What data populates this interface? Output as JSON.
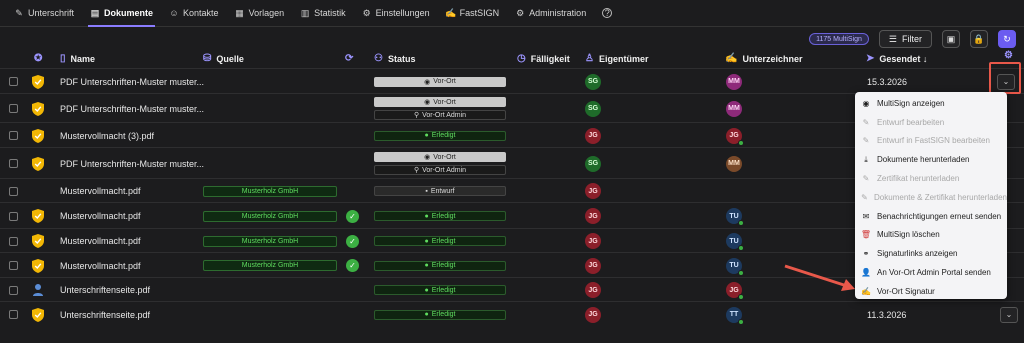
{
  "nav": [
    {
      "label": "Unterschrift",
      "icon": "pen-icon",
      "glyph": "✎",
      "active": false
    },
    {
      "label": "Dokumente",
      "icon": "document-icon",
      "glyph": "▤",
      "active": true
    },
    {
      "label": "Kontakte",
      "icon": "contacts-icon",
      "glyph": "☺",
      "active": false
    },
    {
      "label": "Vorlagen",
      "icon": "templates-icon",
      "glyph": "▦",
      "active": false
    },
    {
      "label": "Statistik",
      "icon": "statistics-icon",
      "glyph": "▥",
      "active": false
    },
    {
      "label": "Einstellungen",
      "icon": "settings-icon",
      "glyph": "⚙",
      "active": false
    },
    {
      "label": "FastSIGN",
      "icon": "fastsign-icon",
      "glyph": "✍",
      "active": false
    },
    {
      "label": "Administration",
      "icon": "admin-gear-icon",
      "glyph": "⚙",
      "active": false
    },
    {
      "label": "",
      "icon": "help-icon",
      "glyph": "?",
      "active": false
    }
  ],
  "toolbar": {
    "multisign_count": "1175 MultiSign",
    "filter_label": "Filter"
  },
  "columns": {
    "name": "Name",
    "source": "Quelle",
    "status": "Status",
    "due": "Fälligkeit",
    "owner": "Eigentümer",
    "signer": "Unterzeichner",
    "sent": "Gesendet ↓"
  },
  "rows": [
    {
      "name": "PDF Unterschriften-Muster muster...",
      "icon": "shield",
      "source": "",
      "synced": false,
      "status": [
        {
          "label": "Vor-Ort",
          "kind": "vor"
        }
      ],
      "owner": "SG",
      "owner_color": "sg",
      "signer": "MM",
      "signer_color": "mm",
      "signer_done": false,
      "sent": "15.3.2026"
    },
    {
      "name": "PDF Unterschriften-Muster muster...",
      "icon": "shield",
      "source": "",
      "synced": false,
      "status": [
        {
          "label": "Vor-Ort",
          "kind": "vor"
        },
        {
          "label": "Vor-Ort Admin",
          "kind": "admin"
        }
      ],
      "owner": "SG",
      "owner_color": "sg",
      "signer": "MM",
      "signer_color": "mm",
      "signer_done": false,
      "sent": ""
    },
    {
      "name": "Mustervollmacht (3).pdf",
      "icon": "shield",
      "source": "",
      "synced": false,
      "status": [
        {
          "label": "Erledigt",
          "kind": "ok"
        }
      ],
      "owner": "JG",
      "owner_color": "jg",
      "signer": "JG",
      "signer_color": "jg",
      "signer_done": true,
      "sent": ""
    },
    {
      "name": "PDF Unterschriften-Muster muster...",
      "icon": "shield",
      "source": "",
      "synced": false,
      "status": [
        {
          "label": "Vor-Ort",
          "kind": "vor"
        },
        {
          "label": "Vor-Ort Admin",
          "kind": "admin"
        }
      ],
      "owner": "SG",
      "owner_color": "sg",
      "signer": "MM",
      "signer_color": "mm2",
      "signer_done": false,
      "sent": ""
    },
    {
      "name": "Mustervollmacht.pdf",
      "icon": "none",
      "source": "Musterholz GmbH",
      "synced": false,
      "status": [
        {
          "label": "Entwurf",
          "kind": "ent"
        }
      ],
      "owner": "JG",
      "owner_color": "jg",
      "signer": "",
      "signer_color": "",
      "signer_done": false,
      "sent": ""
    },
    {
      "name": "Mustervollmacht.pdf",
      "icon": "shield",
      "source": "Musterholz GmbH",
      "synced": true,
      "status": [
        {
          "label": "Erledigt",
          "kind": "ok"
        }
      ],
      "owner": "JG",
      "owner_color": "jg",
      "signer": "TU",
      "signer_color": "tu",
      "signer_done": true,
      "sent": ""
    },
    {
      "name": "Mustervollmacht.pdf",
      "icon": "shield",
      "source": "Musterholz GmbH",
      "synced": true,
      "status": [
        {
          "label": "Erledigt",
          "kind": "ok"
        }
      ],
      "owner": "JG",
      "owner_color": "jg",
      "signer": "TU",
      "signer_color": "tu",
      "signer_done": true,
      "sent": ""
    },
    {
      "name": "Mustervollmacht.pdf",
      "icon": "shield",
      "source": "Musterholz GmbH",
      "synced": true,
      "status": [
        {
          "label": "Erledigt",
          "kind": "ok"
        }
      ],
      "owner": "JG",
      "owner_color": "jg",
      "signer": "TU",
      "signer_color": "tu",
      "signer_done": true,
      "sent": ""
    },
    {
      "name": "Unterschriftenseite.pdf",
      "icon": "person",
      "source": "",
      "synced": false,
      "status": [
        {
          "label": "Erledigt",
          "kind": "ok"
        }
      ],
      "owner": "JG",
      "owner_color": "jg",
      "signer": "JG",
      "signer_color": "jg",
      "signer_done": true,
      "sent": ""
    },
    {
      "name": "Unterschriftenseite.pdf",
      "icon": "shield",
      "source": "",
      "synced": false,
      "status": [
        {
          "label": "Erledigt",
          "kind": "ok"
        }
      ],
      "owner": "JG",
      "owner_color": "jg",
      "signer": "TT",
      "signer_color": "tu",
      "signer_done": true,
      "sent": "11.3.2026"
    }
  ],
  "menu": [
    {
      "label": "MultiSign anzeigen",
      "icon": "eye-icon",
      "glyph": "◉",
      "disabled": false,
      "danger": false
    },
    {
      "label": "Entwurf bearbeiten",
      "icon": "edit-icon",
      "glyph": "✎",
      "disabled": true,
      "danger": false
    },
    {
      "label": "Entwurf in FastSIGN bearbeiten",
      "icon": "edit-fastsign-icon",
      "glyph": "✎",
      "disabled": true,
      "danger": false
    },
    {
      "label": "Dokumente herunterladen",
      "icon": "download-icon",
      "glyph": "⤓",
      "disabled": false,
      "danger": false
    },
    {
      "label": "Zertifikat herunterladen",
      "icon": "certificate-icon",
      "glyph": "✎",
      "disabled": true,
      "danger": false
    },
    {
      "label": "Dokumente & Zertifikat herunterladen",
      "icon": "download-all-icon",
      "glyph": "✎",
      "disabled": true,
      "danger": false
    },
    {
      "label": "Benachrichtigungen erneut senden",
      "icon": "mail-icon",
      "glyph": "✉",
      "disabled": false,
      "danger": false
    },
    {
      "label": "MultiSign löschen",
      "icon": "trash-icon",
      "glyph": "🗑",
      "disabled": false,
      "danger": true
    },
    {
      "label": "Signaturlinks anzeigen",
      "icon": "link-icon",
      "glyph": "⚭",
      "disabled": false,
      "danger": false
    },
    {
      "label": "An Vor-Ort Admin Portal senden",
      "icon": "admin-send-icon",
      "glyph": "👤",
      "disabled": false,
      "danger": false
    },
    {
      "label": "Vor-Ort Signatur",
      "icon": "onsite-sign-icon",
      "glyph": "✍",
      "disabled": false,
      "danger": false
    }
  ],
  "colors": {
    "accent": "#6b5cf0",
    "highlight": "#e8584a",
    "ok": "#3cb043"
  }
}
